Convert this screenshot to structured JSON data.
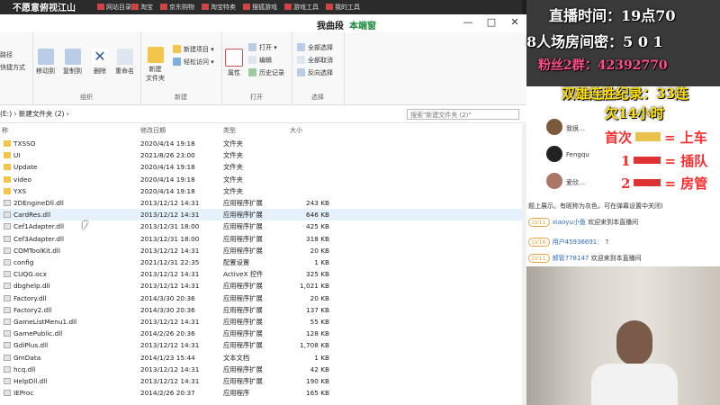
{
  "browser": {
    "overlay_title": "不愿意俯视江山",
    "bookmarks": [
      "",
      "网站目录",
      "淘宝",
      "京东购物",
      "淘宝特卖",
      "搜狐游戏",
      "游戏工具",
      "我的工具"
    ]
  },
  "window": {
    "title": "我曲段",
    "subtitle": "本端窗",
    "min": "—",
    "max": "□",
    "close": "✕"
  },
  "ribbon": {
    "clipboard_items": [
      "路径",
      "快捷方式"
    ],
    "organize_group": "组织",
    "move_to": "移动到",
    "copy_to": "复制到",
    "delete": "删除",
    "rename": "重命名",
    "new_group": "新建",
    "new_folder": "新建\n文件夹",
    "new_item": "新建项目 ▾",
    "easy_access": "轻松访问 ▾",
    "open_group": "打开",
    "properties": "属性",
    "open": "打开 ▾",
    "edit": "编辑",
    "history": "历史记录",
    "select_group": "选择",
    "select_all": "全部选择",
    "select_none": "全部取消",
    "invert": "反向选择"
  },
  "address": {
    "path": "(E:) › 新建文件夹 (2) ›",
    "search_placeholder": "搜索\"新建文件夹 (2)\""
  },
  "columns": {
    "name": "称",
    "modified": "修改日期",
    "type": "类型",
    "size": "大小"
  },
  "files": [
    {
      "name": "TXSSO",
      "date": "2020/4/14 19:18",
      "type": "文件夹",
      "size": "",
      "kind": "folder"
    },
    {
      "name": "UI",
      "date": "2021/8/26 23:00",
      "type": "文件夹",
      "size": "",
      "kind": "folder"
    },
    {
      "name": "Update",
      "date": "2020/4/14 19:18",
      "type": "文件夹",
      "size": "",
      "kind": "folder"
    },
    {
      "name": "video",
      "date": "2020/4/14 19:18",
      "type": "文件夹",
      "size": "",
      "kind": "folder"
    },
    {
      "name": "YXS",
      "date": "2020/4/14 19:18",
      "type": "文件夹",
      "size": "",
      "kind": "folder"
    },
    {
      "name": "2DEngineDll.dll",
      "date": "2013/12/12 14:31",
      "type": "应用程序扩展",
      "size": "243 KB",
      "kind": "dll"
    },
    {
      "name": "CardRes.dll",
      "date": "2013/12/12 14:31",
      "type": "应用程序扩展",
      "size": "646 KB",
      "kind": "dll"
    },
    {
      "name": "Cef1Adapter.dll",
      "date": "2013/12/31 18:00",
      "type": "应用程序扩展",
      "size": "425 KB",
      "kind": "dll"
    },
    {
      "name": "Cef3Adapter.dll",
      "date": "2013/12/31 18:00",
      "type": "应用程序扩展",
      "size": "318 KB",
      "kind": "dll"
    },
    {
      "name": "COMToolKit.dll",
      "date": "2013/12/12 14:31",
      "type": "应用程序扩展",
      "size": "20 KB",
      "kind": "dll"
    },
    {
      "name": "config",
      "date": "2021/12/31 22:35",
      "type": "配置设置",
      "size": "1 KB",
      "kind": "dll"
    },
    {
      "name": "CUQG.ocx",
      "date": "2013/12/12 14:31",
      "type": "ActiveX 控件",
      "size": "325 KB",
      "kind": "dll"
    },
    {
      "name": "dbghelp.dll",
      "date": "2013/12/12 14:31",
      "type": "应用程序扩展",
      "size": "1,021 KB",
      "kind": "dll"
    },
    {
      "name": "Factory.dll",
      "date": "2014/3/30 20:36",
      "type": "应用程序扩展",
      "size": "20 KB",
      "kind": "dll"
    },
    {
      "name": "Factory2.dll",
      "date": "2014/3/30 20:36",
      "type": "应用程序扩展",
      "size": "137 KB",
      "kind": "dll"
    },
    {
      "name": "GameListMenu1.dll",
      "date": "2013/12/12 14:31",
      "type": "应用程序扩展",
      "size": "55 KB",
      "kind": "dll"
    },
    {
      "name": "GamePublic.dll",
      "date": "2014/2/26 20:36",
      "type": "应用程序扩展",
      "size": "128 KB",
      "kind": "dll"
    },
    {
      "name": "GdiPlus.dll",
      "date": "2013/12/12 14:31",
      "type": "应用程序扩展",
      "size": "1,708 KB",
      "kind": "dll"
    },
    {
      "name": "GmData",
      "date": "2014/1/23 15:44",
      "type": "文本文档",
      "size": "1 KB",
      "kind": "dll"
    },
    {
      "name": "hcq.dll",
      "date": "2013/12/12 14:31",
      "type": "应用程序扩展",
      "size": "42 KB",
      "kind": "dll"
    },
    {
      "name": "HelpDll.dll",
      "date": "2013/12/12 14:31",
      "type": "应用程序扩展",
      "size": "190 KB",
      "kind": "dll"
    },
    {
      "name": "IEProc",
      "date": "2014/2/26 20:37",
      "type": "应用程序",
      "size": "165 KB",
      "kind": "dll"
    }
  ],
  "overlay": {
    "live_time": "直播时间：19点70",
    "room_pw": "8人场房间密：5 0 1",
    "fan_group": "粉丝2群：42392770",
    "record": "双雄连胜纪录：33连",
    "record2": "欠14小时",
    "rule1": "首次",
    "rule1b": "= 上车",
    "rule2": "1",
    "rule2b": "= 插队",
    "rule3": "2",
    "rule3b": "= 房管"
  },
  "chat": {
    "names": [
      "我很…",
      "Fengqu",
      "爱欣…"
    ],
    "notice": "题上展示。有昵称为灰色，可在弹幕设置中关闭)",
    "messages": [
      {
        "lv": "LV11",
        "user": "xiaoyu小鱼",
        "text": "欢迎来到本直播间"
      },
      {
        "lv": "LV16",
        "user": "用户45936691：",
        "text": "?"
      },
      {
        "lv": "LV11",
        "user": "郝管778147",
        "text": "欢迎来到本直播间"
      }
    ]
  }
}
